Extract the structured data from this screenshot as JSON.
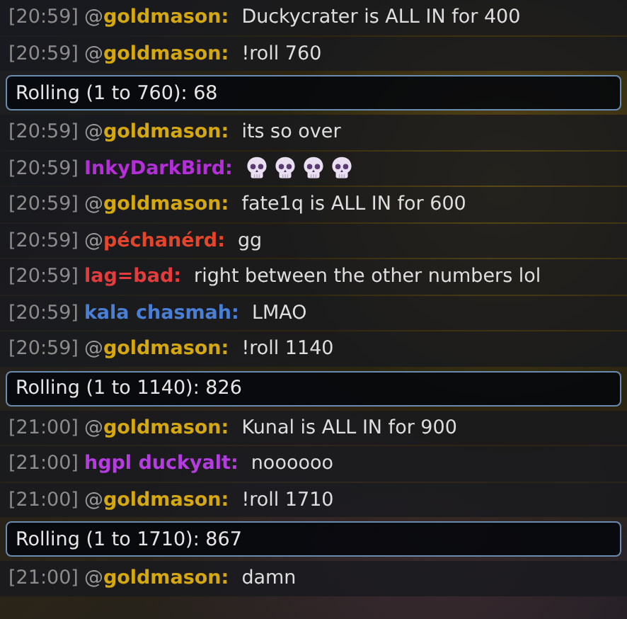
{
  "messages": [
    {
      "kind": "chat",
      "time": "[20:59]",
      "prefix": "@",
      "user": "goldmason:",
      "color": "#d6a80f",
      "text": "Duckycrater is ALL IN for 400"
    },
    {
      "kind": "chat",
      "time": "[20:59]",
      "prefix": "@",
      "user": "goldmason:",
      "color": "#d6a80f",
      "text": "!roll 760"
    },
    {
      "kind": "roll",
      "text": "Rolling (1 to 760): 68"
    },
    {
      "kind": "chat",
      "time": "[20:59]",
      "prefix": "@",
      "user": "goldmason:",
      "color": "#d6a80f",
      "text": "its so over"
    },
    {
      "kind": "chat",
      "time": "[20:59]",
      "user": "InkyDarkBird:",
      "color": "#b42fd8",
      "emotes": [
        {
          "kind": "skull"
        },
        {
          "kind": "skull"
        },
        {
          "kind": "skull"
        },
        {
          "kind": "skull"
        }
      ]
    },
    {
      "kind": "chat",
      "time": "[20:59]",
      "prefix": "@",
      "user": "goldmason:",
      "color": "#d6a80f",
      "text": "fate1q is ALL IN for 600"
    },
    {
      "kind": "chat",
      "time": "[20:59]",
      "prefix": "@",
      "user": "péchanérd:",
      "color": "#e5452b",
      "text": "gg"
    },
    {
      "kind": "chat",
      "time": "[20:59]",
      "user": "lag=bad:",
      "color": "#e43c3c",
      "text": "right between the other numbers lol"
    },
    {
      "kind": "chat",
      "time": "[20:59]",
      "user": "kala chasmah:",
      "color": "#4a7fd6",
      "text": "LMAO"
    },
    {
      "kind": "chat",
      "time": "[20:59]",
      "prefix": "@",
      "user": "goldmason:",
      "color": "#d6a80f",
      "text": "!roll 1140"
    },
    {
      "kind": "roll",
      "text": "Rolling (1 to 1140): 826"
    },
    {
      "kind": "chat",
      "time": "[21:00]",
      "prefix": "@",
      "user": "goldmason:",
      "color": "#d6a80f",
      "text": "Kunal is ALL IN for 900"
    },
    {
      "kind": "chat",
      "time": "[21:00]",
      "user": "hgpl duckyalt:",
      "color": "#b43ce0",
      "text": "noooooo"
    },
    {
      "kind": "chat",
      "time": "[21:00]",
      "prefix": "@",
      "user": "goldmason:",
      "color": "#d6a80f",
      "text": "!roll 1710"
    },
    {
      "kind": "roll",
      "text": "Rolling (1 to 1710): 867"
    },
    {
      "kind": "chat",
      "time": "[21:00]",
      "prefix": "@",
      "user": "goldmason:",
      "color": "#d6a80f",
      "text": "damn"
    }
  ]
}
